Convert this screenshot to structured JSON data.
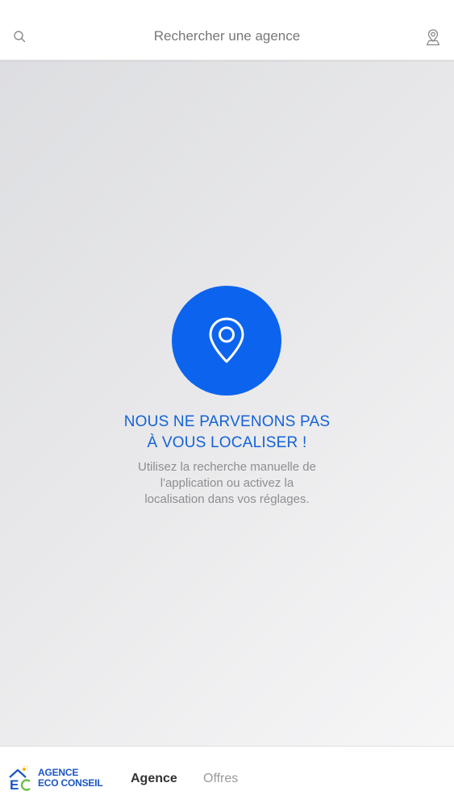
{
  "header": {
    "search_placeholder": "Rechercher une agence",
    "left_icon": "search-icon",
    "right_icon": "location-user-icon"
  },
  "empty_state": {
    "icon": "map-pin-icon",
    "title_line1": "NOUS NE PARVENONS PAS",
    "title_line2": "À VOUS LOCALISER !",
    "message_line1": "Utilisez la recherche manuelle de",
    "message_line2": "l'application ou activez la",
    "message_line3": "localisation dans vos réglages."
  },
  "bottom_nav": {
    "logo": {
      "line1": "AGENCE",
      "line2": "ECO CONSEIL"
    },
    "tabs": [
      {
        "label": "Agence",
        "active": true
      },
      {
        "label": "Offres",
        "active": false
      }
    ]
  },
  "colors": {
    "accent": "#0c64ee",
    "headline": "#1462d8",
    "muted": "#8e8e92",
    "active_tab": "#333333",
    "inactive_tab": "#9a9a9a"
  }
}
